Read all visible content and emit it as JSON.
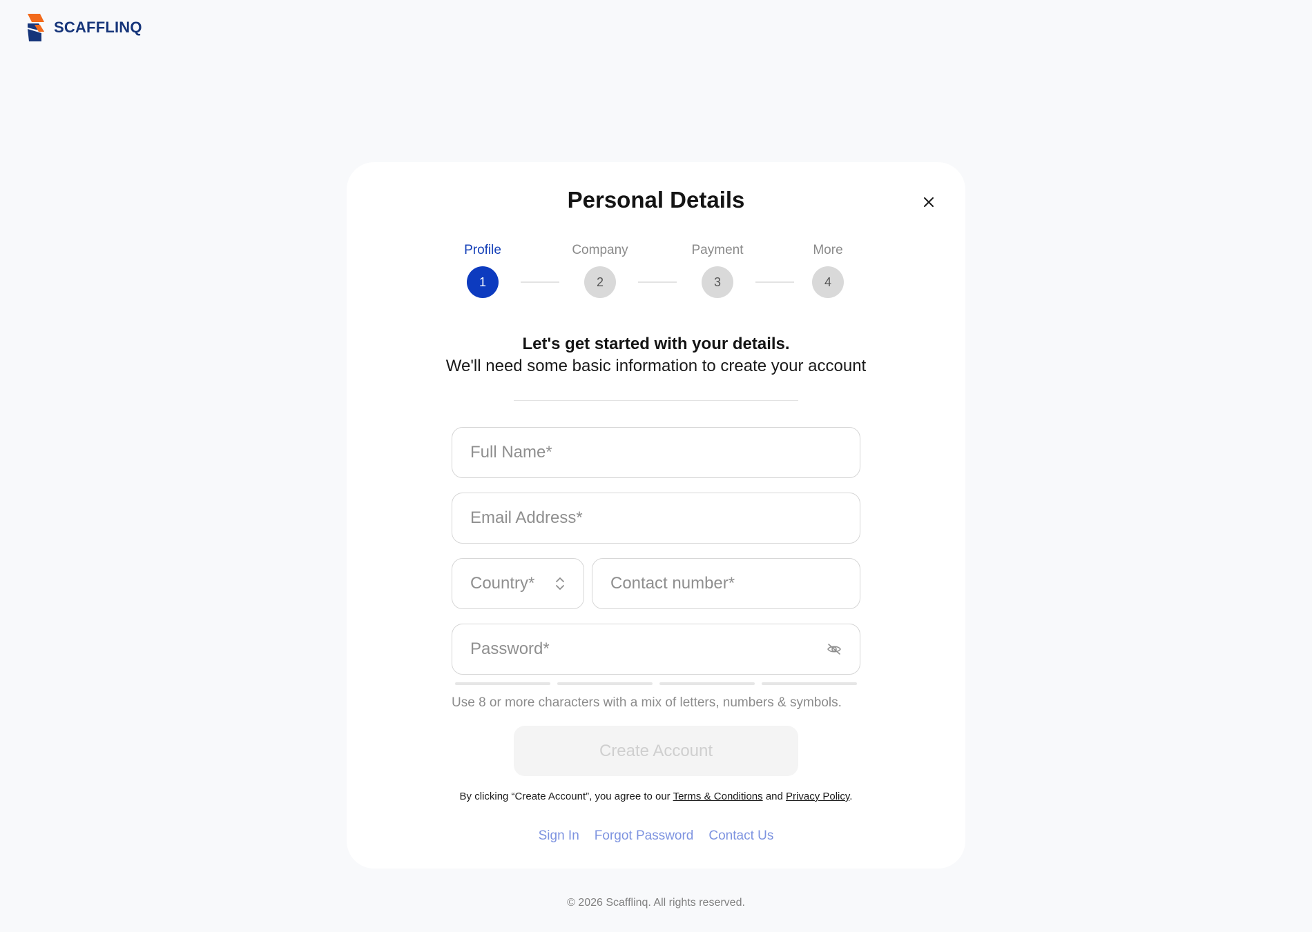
{
  "brand": {
    "name": "SCAFFLINQ",
    "primary_color": "#16357a",
    "accent_color": "#f26a1b"
  },
  "modal": {
    "title": "Personal Details",
    "close_icon": "close-icon"
  },
  "steps": [
    {
      "label": "Profile",
      "number": "1",
      "active": true
    },
    {
      "label": "Company",
      "number": "2",
      "active": false
    },
    {
      "label": "Payment",
      "number": "3",
      "active": false
    },
    {
      "label": "More",
      "number": "4",
      "active": false
    }
  ],
  "intro": {
    "title": "Let's get started with your details.",
    "subtitle": "We'll need some basic information to create your account"
  },
  "form": {
    "full_name": {
      "placeholder": "Full Name*",
      "value": ""
    },
    "email": {
      "placeholder": "Email Address*",
      "value": ""
    },
    "country": {
      "placeholder": "Country*",
      "value": "",
      "icon": "chevron-up-down-icon"
    },
    "contact": {
      "placeholder": "Contact number*",
      "value": ""
    },
    "password": {
      "placeholder": "Password*",
      "value": "",
      "icon": "eye-off-icon"
    },
    "password_hint": "Use 8 or more characters with a mix of letters, numbers & symbols.",
    "strength_level": 0
  },
  "actions": {
    "create_account": "Create Account",
    "agree_prefix": "By clicking “Create Account”, you agree to our",
    "terms": "Terms & Conditions",
    "and": "and",
    "privacy": "Privacy Policy",
    "period": "."
  },
  "links": {
    "sign_in": "Sign In",
    "forgot_password": "Forgot Password",
    "contact_us": "Contact Us"
  },
  "footer": {
    "copyright": "© 2026 Scafflinq. All rights reserved."
  }
}
